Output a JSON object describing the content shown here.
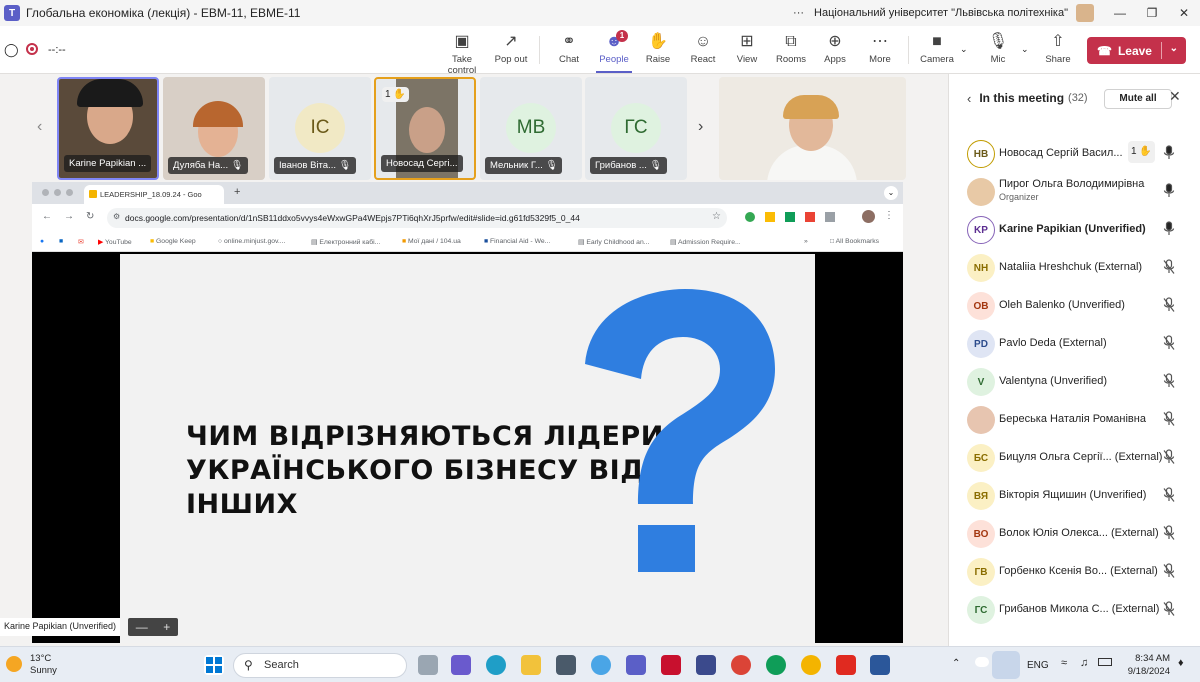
{
  "window": {
    "title": "Глобальна економіка (лекція) - ЕВМ-11, ЕВМЕ-11",
    "org": "Національний університет \"Львівська політехніка\"",
    "more": "···"
  },
  "toolbar": {
    "timer": "--:--",
    "take_control": "Take control",
    "pop_out": "Pop out",
    "chat": "Chat",
    "people": "People",
    "people_badge": "1",
    "raise": "Raise",
    "react": "React",
    "view": "View",
    "rooms": "Rooms",
    "apps": "Apps",
    "more": "More",
    "camera": "Camera",
    "mic": "Mic",
    "share": "Share",
    "leave": "Leave"
  },
  "video_tiles": [
    {
      "name": "Karine Papikian ..."
    },
    {
      "name": "Дуляба На..."
    },
    {
      "name": "Іванов Віта...",
      "initials": "ІС"
    },
    {
      "name": "Новосад Сергі...",
      "hand": "1"
    },
    {
      "name": "Мельник Г...",
      "initials": "МВ"
    },
    {
      "name": "Грибанов ...",
      "initials": "ГС"
    }
  ],
  "shared_screen": {
    "tab_title": "LEADERSHIP_18.09.24 - Goo",
    "url": "docs.google.com/presentation/d/1nSB11ddxo5vvys4eWxwGPa4WEpjs7PTi6qhXrJ5prfw/edit#slide=id.g61fd5329f5_0_44",
    "bookmarks": [
      "YouTube",
      "Google Keep",
      "online.minjust.gov....",
      "Електронний кабі...",
      "Мої дані / 104.ua",
      "Financial Aid - We...",
      "Early Childhood an...",
      "Admission Require..."
    ],
    "all_bookmarks": "All Bookmarks",
    "slide_line1": "ЧИМ ВІДРІЗНЯЮТЬСЯ ЛІДЕРИ",
    "slide_line2": "УКРАЇНСЬКОГО БІЗНЕСУ ВІД",
    "slide_line3": "ІНШИХ",
    "qmark_color": "#2f7ee0"
  },
  "presenter_label": "Karine Papikian (Unverified)",
  "zoom": {
    "minus": "—",
    "plus": "+"
  },
  "panel": {
    "title": "In this meeting",
    "count": "(32)",
    "mute_all": "Mute all",
    "people": [
      {
        "initials": "НВ",
        "name": "Новосад Сергій Васил...",
        "hand": "1",
        "mic": "on",
        "bg": "#fff",
        "border": "#c19c00",
        "fg": "#6b5a19"
      },
      {
        "initials": "",
        "name": "Пирог Ольга Володимирівна",
        "role": "Organizer",
        "mic": "on",
        "bg": "#e8c9a6",
        "fg": "#6b4a2a"
      },
      {
        "initials": "KP",
        "name": "Karine Papikian (Unverified)",
        "mic": "on",
        "bg": "#fff",
        "border": "#8764b8",
        "fg": "#5c2e91",
        "bold": true
      },
      {
        "initials": "NH",
        "name": "Nataliia Hreshchuk (External)",
        "mic": "off",
        "bg": "#fbf0c4",
        "fg": "#8a6d00"
      },
      {
        "initials": "OB",
        "name": "Oleh Balenko (Unverified)",
        "mic": "off",
        "bg": "#fde1d9",
        "fg": "#a3360f"
      },
      {
        "initials": "PD",
        "name": "Pavlo Deda (External)",
        "mic": "off",
        "bg": "#dfe5f4",
        "fg": "#2c4b8c"
      },
      {
        "initials": "V",
        "name": "Valentyna (Unverified)",
        "mic": "off",
        "bg": "#dff2e0",
        "fg": "#2f6b32"
      },
      {
        "initials": "",
        "name": "Береська Наталія Романівна",
        "mic": "off",
        "bg": "#e7c5b0",
        "fg": "#6b3a20"
      },
      {
        "initials": "БС",
        "name": "Бицуля Ольга Сергії... (External)",
        "mic": "off",
        "bg": "#fbf0c4",
        "fg": "#8a6d00"
      },
      {
        "initials": "ВЯ",
        "name": "Вікторія Ящишин (Unverified)",
        "mic": "off",
        "bg": "#fbf0c4",
        "fg": "#8a6d00"
      },
      {
        "initials": "ВО",
        "name": "Волок Юлія Олекса... (External)",
        "mic": "off",
        "bg": "#fde1d9",
        "fg": "#a3360f"
      },
      {
        "initials": "ГВ",
        "name": "Горбенко Ксенія Во... (External)",
        "mic": "off",
        "bg": "#fbf0c4",
        "fg": "#8a6d00"
      },
      {
        "initials": "ГС",
        "name": "Грибанов Микола С... (External)",
        "mic": "off",
        "bg": "#dff2e0",
        "fg": "#2f6b32"
      }
    ]
  },
  "taskbar": {
    "temp": "13°C",
    "weather": "Sunny",
    "search": "Search",
    "lang": "ENG",
    "time": "8:34 AM",
    "date": "9/18/2024"
  }
}
